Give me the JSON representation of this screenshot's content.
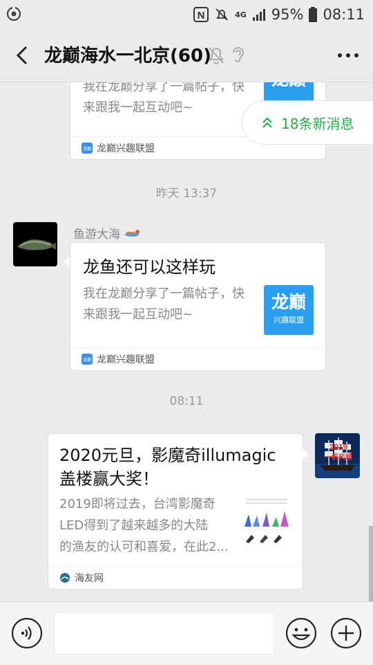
{
  "status_bar": {
    "network": "4G",
    "battery": "95%",
    "time": "08:11"
  },
  "header": {
    "title": "龙巅海水一北京(60)"
  },
  "new_messages": {
    "label": "18条新消息"
  },
  "messages": [
    {
      "type": "link_card",
      "title": "",
      "desc_line1": "我在龙巅分享了一篇帖子，快",
      "desc_line2": "来跟我一起互动吧~",
      "thumb_text": "龙巅",
      "source": "龙巅兴趣联盟"
    },
    {
      "type": "timestamp",
      "text": "昨天 13:37"
    },
    {
      "type": "link_card",
      "sender": "鱼游大海",
      "title": "龙鱼还可以这样玩",
      "desc_line1": "我在龙巅分享了一篇帖子，快",
      "desc_line2": "来跟我一起互动吧~",
      "thumb_text": "龙巅",
      "thumb_sub": "兴趣联盟",
      "source": "龙巅兴趣联盟"
    },
    {
      "type": "timestamp",
      "text": "08:11"
    },
    {
      "type": "link_card",
      "title_line1": "2020元旦，影魔奇illumagic",
      "title_line2": "盖楼赢大奖！",
      "desc_line1": "2019即将过去，台湾影魔奇",
      "desc_line2": "LED得到了越来越多的大陆",
      "desc_line3": "的渔友的认可和喜爱，在此2...",
      "source": "海友网",
      "avatar_text_1": "2019",
      "avatar_text_2": "一帆风顺"
    }
  ],
  "colors": {
    "background": "#ebebeb",
    "accent_green": "#2aa84a",
    "brand_blue": "#2a9ef0"
  }
}
